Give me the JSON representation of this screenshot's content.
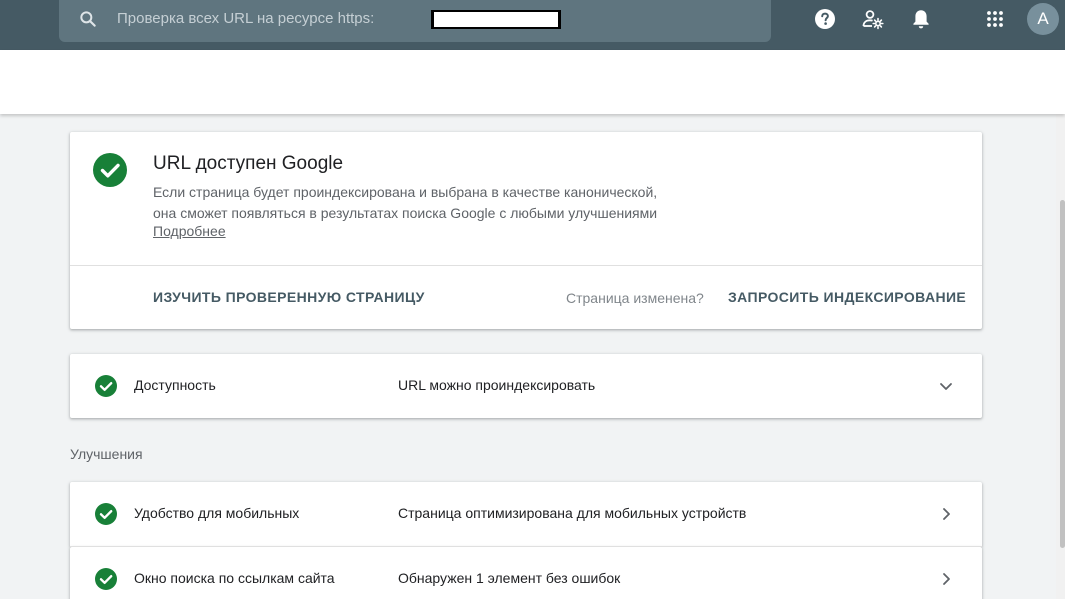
{
  "search": {
    "placeholder": "Проверка всех URL на ресурсе https:"
  },
  "header": {
    "avatar_letter": "A"
  },
  "icons": {
    "search": "search-icon",
    "help": "help-icon",
    "users_settings": "manage-accounts-icon",
    "notifications": "bell-icon",
    "apps": "apps-grid-icon",
    "check": "check-circle-icon",
    "expand": "chevron-down-icon",
    "navigate": "chevron-right-icon"
  },
  "colors": {
    "topbar": "#455a64",
    "success": "#188038",
    "action": "#455a64"
  },
  "status_card": {
    "title": "URL доступен Google",
    "description_line1": "Если страница будет проиндексирована и выбрана в качестве канонической,",
    "description_line2": "она сможет появляться в результатах поиска Google с любыми улучшениями",
    "learn_more": "Подробнее",
    "inspect_button": "ИЗУЧИТЬ ПРОВЕРЕННУЮ СТРАНИЦУ",
    "changed_question": "Страница изменена?",
    "request_indexing_button": "ЗАПРОСИТЬ ИНДЕКСИРОВАНИЕ"
  },
  "availability": {
    "name": "Доступность",
    "status": "URL можно проиндексировать"
  },
  "enhancements": {
    "label": "Улучшения",
    "items": [
      {
        "name": "Удобство для мобильных",
        "status": "Страница оптимизирована для мобильных устройств"
      },
      {
        "name": "Окно поиска по ссылкам сайта",
        "status": "Обнаружен 1 элемент без ошибок"
      }
    ]
  }
}
